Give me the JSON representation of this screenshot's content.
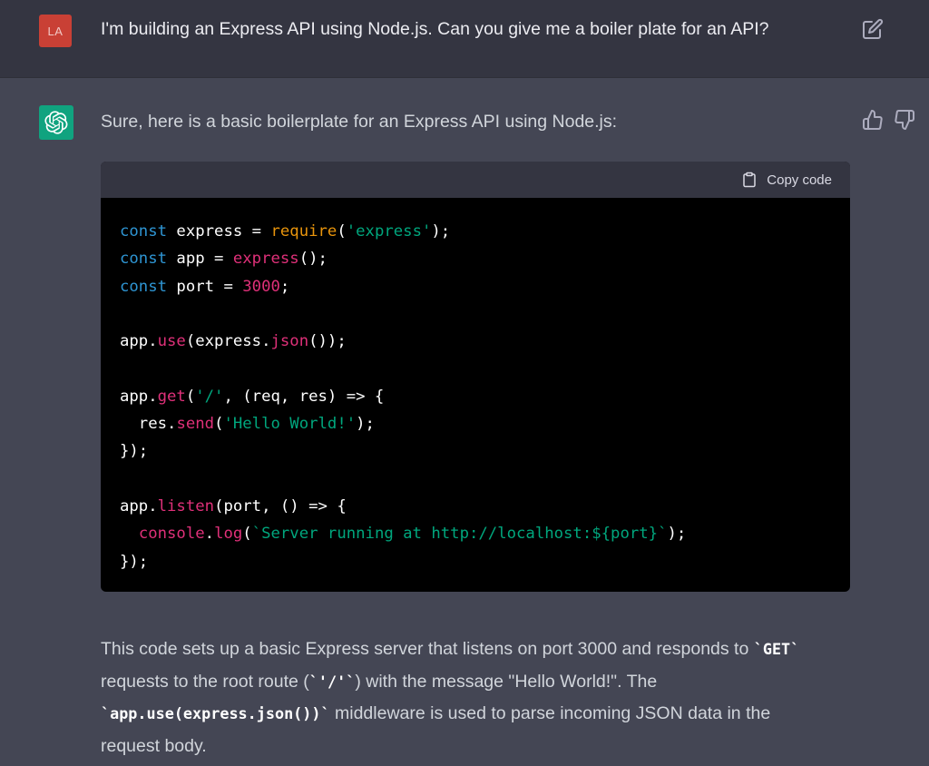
{
  "user_message": {
    "avatar_initials": "LA",
    "avatar_color": "#c94035",
    "text": "I'm building an Express API using Node.js. Can you give me a boiler plate for an API?",
    "edit_icon": "edit-icon"
  },
  "assistant_message": {
    "avatar_icon": "openai-logo-icon",
    "avatar_color": "#10a37f",
    "intro": "Sure, here is a basic boilerplate for an Express API using Node.js:",
    "feedback_icons": [
      "thumbs-up-icon",
      "thumbs-down-icon"
    ],
    "code_block": {
      "copy_label": "Copy code",
      "language": "javascript",
      "lines": [
        "const express = require('express');",
        "const app = express();",
        "const port = 3000;",
        "",
        "app.use(express.json());",
        "",
        "app.get('/', (req, res) => {",
        "  res.send('Hello World!');",
        "});",
        "",
        "app.listen(port, () => {",
        "  console.log(`Server running at http://localhost:${port}`);",
        "});"
      ]
    },
    "explanation": {
      "part1": "This code sets up a basic Express server that listens on port 3000 and responds to ",
      "code1": "`GET`",
      "part2": " requests to the root route (",
      "code2": "`'/'`",
      "part3": ") with the message \"Hello World!\". The ",
      "code3": "`app.use(express.json())`",
      "part4": " middleware is used to parse incoming JSON data in the request body."
    }
  },
  "colors": {
    "user_bg": "#343541",
    "assistant_bg": "#444654",
    "code_bg": "#000000",
    "keyword": "#2e95d3",
    "function": "#df3079",
    "string": "#00a67d"
  }
}
